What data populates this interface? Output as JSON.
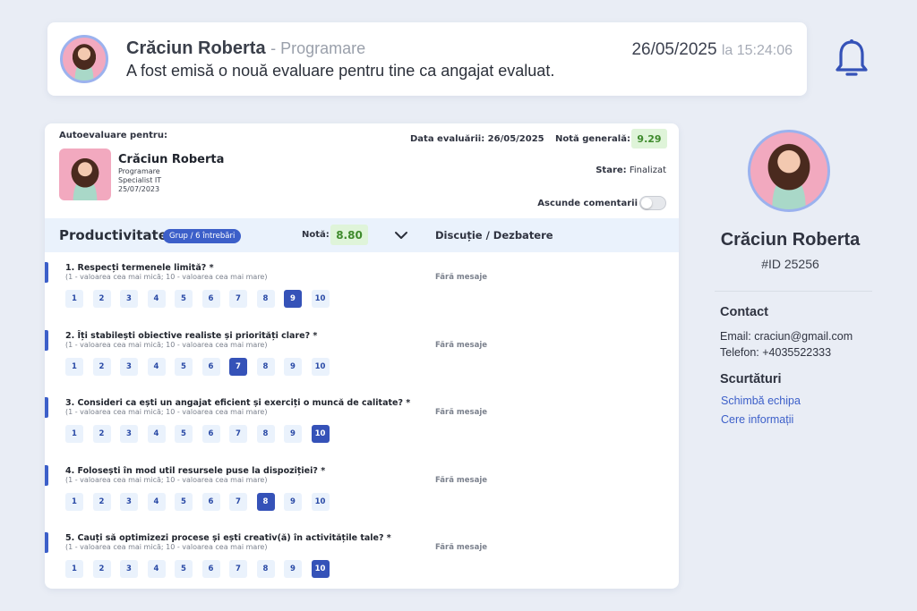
{
  "notification": {
    "name": "Crăciun Roberta",
    "role": "- Programare",
    "message": "A fost emisă o nouă evaluare pentru tine ca angajat evaluat.",
    "date": "26/05/2025",
    "time": "la 15:24:06"
  },
  "evaluation": {
    "self_label": "Autoevaluare pentru:",
    "employee": {
      "name": "Crăciun Roberta",
      "department": "Programare",
      "position": "Specialist IT",
      "date": "25/07/2023"
    },
    "eval_date": "Data evaluării: 26/05/2025",
    "grade_label": "Notă generală:",
    "grade": "9.29",
    "state_label": "Stare:",
    "state_value": "Finalizat",
    "hide_comments_label": "Ascunde comentarii",
    "section": {
      "title": "Productivitate",
      "group_pill": "Grup / 6 întrebări",
      "note_label": "Notă:",
      "note": "8.80",
      "discussion_label": "Discuție / Dezbatere"
    },
    "hint": "(1 - valoarea cea mai mică; 10 - valoarea cea mai mare)",
    "no_messages": "Fără mesaje",
    "scale": [
      "1",
      "2",
      "3",
      "4",
      "5",
      "6",
      "7",
      "8",
      "9",
      "10"
    ],
    "questions": [
      {
        "title": "1. Respecți termenele limită? *",
        "selected": 9
      },
      {
        "title": "2. Îți stabilești obiective realiste și priorități clare? *",
        "selected": 7
      },
      {
        "title": "3. Consideri ca ești un angajat eficient și exerciți o muncă de calitate? *",
        "selected": 10
      },
      {
        "title": "4. Folosești în mod util resursele puse la dispoziției? *",
        "selected": 8
      },
      {
        "title": "5. Cauți să optimizezi procese și ești creativ(ă) în activitățile tale? *",
        "selected": 10
      }
    ]
  },
  "profile": {
    "name": "Crăciun Roberta",
    "id": "#ID 25256",
    "contact_heading": "Contact",
    "email": "Email: craciun@gmail.com",
    "phone": "Telefon: +4035522333",
    "shortcuts_heading": "Scurtături",
    "links": [
      "Schimbă echipa",
      "Cere informații"
    ]
  },
  "colors": {
    "accent": "#3c5fc9",
    "grade_bg": "#dff4d9",
    "grade_text": "#3e8a2c",
    "section_bg": "#eaf2fc"
  },
  "icons": [
    "bell-icon",
    "chevron-down-icon",
    "toggle-switch"
  ]
}
